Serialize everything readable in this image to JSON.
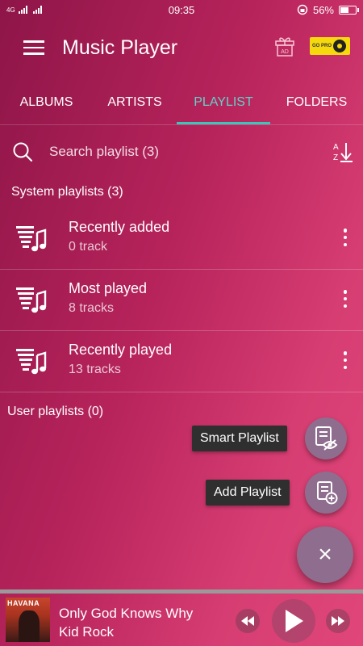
{
  "status_bar": {
    "signal_text": "4G",
    "time": "09:35",
    "battery_percent_text": "56%",
    "battery_level": 0.56
  },
  "app_bar": {
    "title": "Music Player",
    "ad_label": "AD",
    "gopro_label": "GO PRO"
  },
  "tabs": [
    {
      "label": "ALBUMS",
      "active": false
    },
    {
      "label": "ARTISTS",
      "active": false
    },
    {
      "label": "PLAYLIST",
      "active": true
    },
    {
      "label": "FOLDERS",
      "active": false
    }
  ],
  "search": {
    "placeholder": "Search playlist (3)"
  },
  "system_section": {
    "title": "System playlists (3)",
    "items": [
      {
        "name": "Recently added",
        "count": "0 track"
      },
      {
        "name": "Most played",
        "count": "8 tracks"
      },
      {
        "name": "Recently played",
        "count": "13 tracks"
      }
    ]
  },
  "user_section": {
    "title": "User playlists (0)"
  },
  "fab_menu": {
    "smart_playlist_label": "Smart Playlist",
    "add_playlist_label": "Add Playlist",
    "close_symbol": "×"
  },
  "now_playing": {
    "album_art_text": "HAVANA",
    "title": "Only God Knows Why",
    "artist": "Kid Rock",
    "progress": 1.0
  },
  "colors": {
    "accent": "#3cc6ba",
    "fab": "#8f6d8e",
    "label_bg": "#2f2f2f"
  }
}
